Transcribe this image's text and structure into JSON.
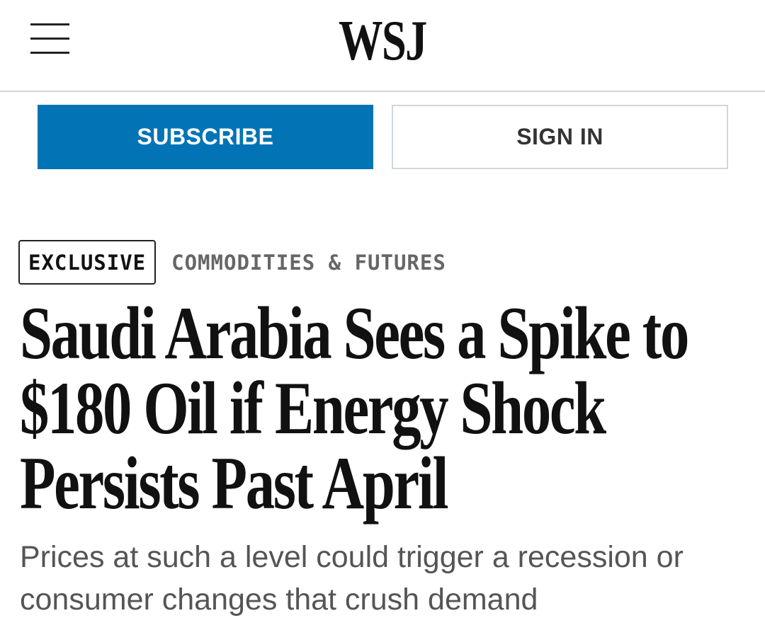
{
  "header": {
    "logo": "WSJ",
    "menu_icon": "hamburger-menu-icon"
  },
  "actions": {
    "subscribe_label": "SUBSCRIBE",
    "signin_label": "SIGN IN"
  },
  "article": {
    "badge": "EXCLUSIVE",
    "section": "COMMODITIES & FUTURES",
    "headline": "Saudi Arabia Sees a Spike to $180 Oil if Energy Shock Persists Past April",
    "dek": "Prices at such a level could trigger a recession or consumer changes that crush demand"
  },
  "colors": {
    "subscribe_bg": "#0274b6",
    "headline_text": "#111111",
    "dek_text": "#555555",
    "section_text": "#666666"
  }
}
